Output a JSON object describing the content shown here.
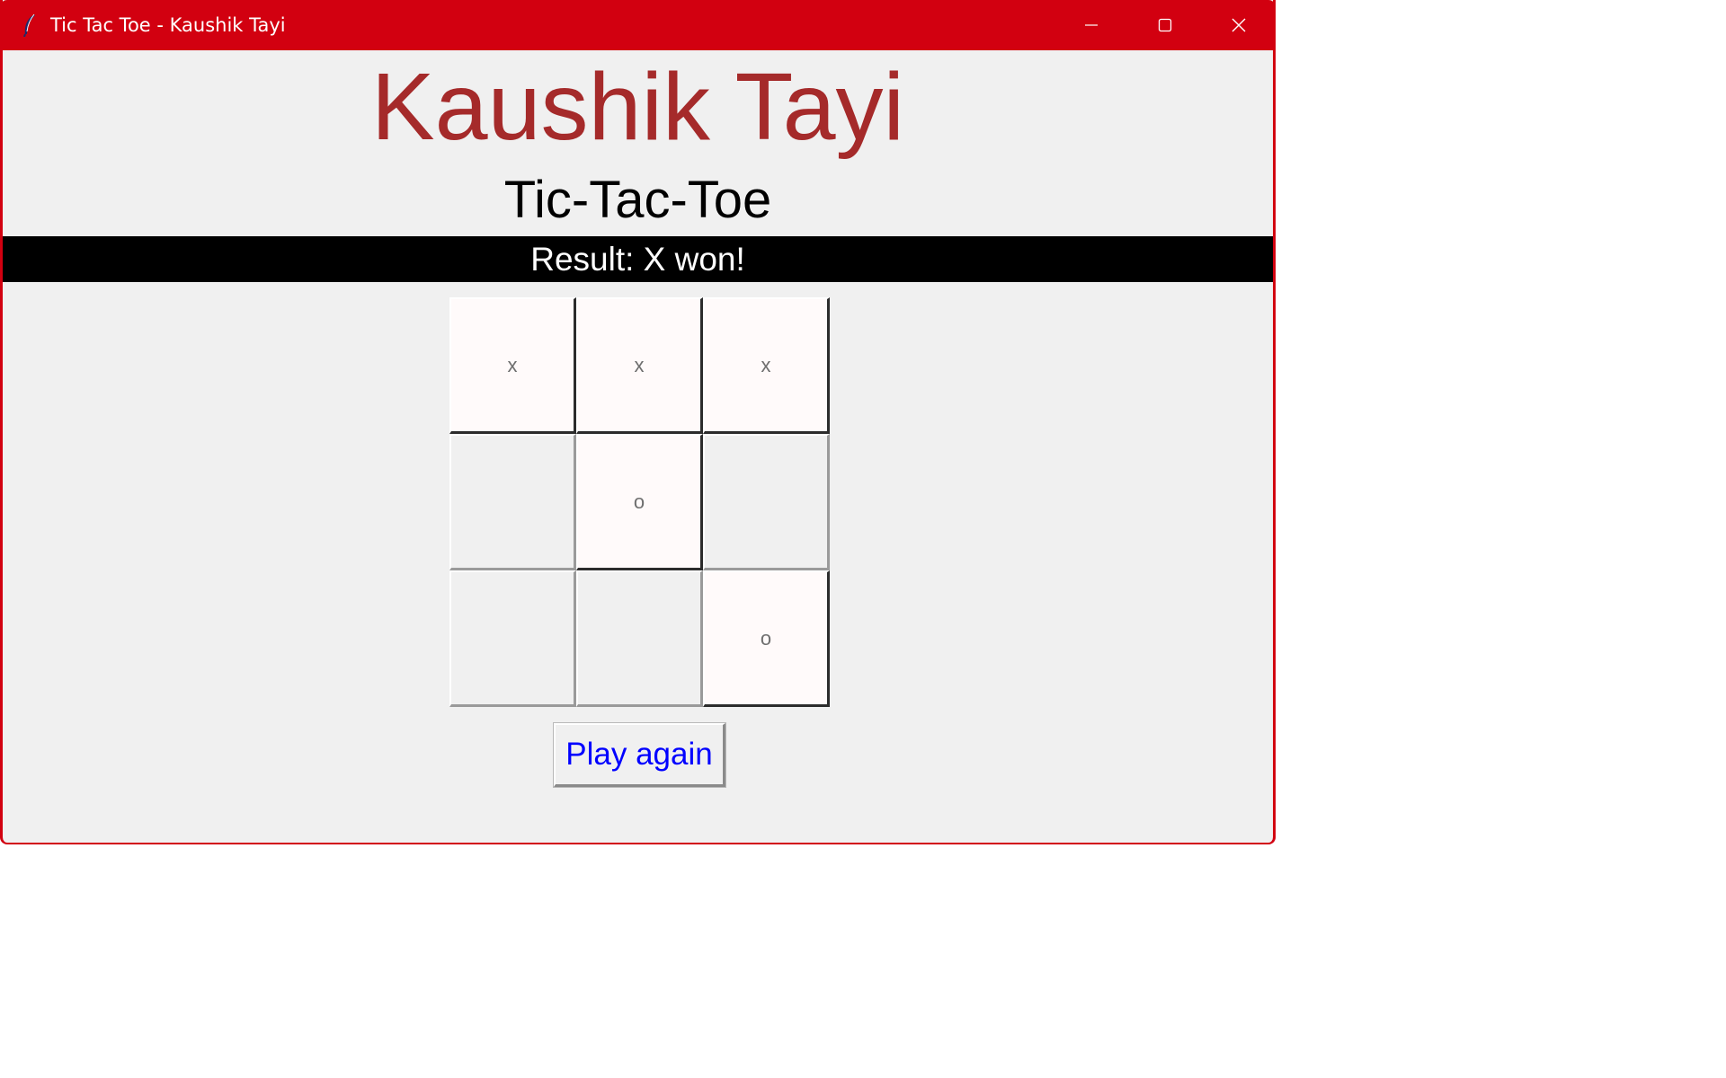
{
  "window": {
    "title": "Tic Tac Toe - Kaushik Tayi",
    "app_icon": "feather-icon",
    "controls": [
      "minimize-icon",
      "maximize-icon",
      "close-icon"
    ]
  },
  "heading": "Kaushik Tayi",
  "subheading": "Tic-Tac-Toe",
  "result": "Result: X won!",
  "board": {
    "cells": [
      [
        "x",
        "x",
        "x"
      ],
      [
        "",
        "o",
        ""
      ],
      [
        "",
        "",
        "o"
      ]
    ]
  },
  "play_again_label": "Play again",
  "colors": {
    "titlebar": "#d20010",
    "heading": "#a52a2a",
    "result_bar": "#000000",
    "button_text": "#0000ff"
  }
}
